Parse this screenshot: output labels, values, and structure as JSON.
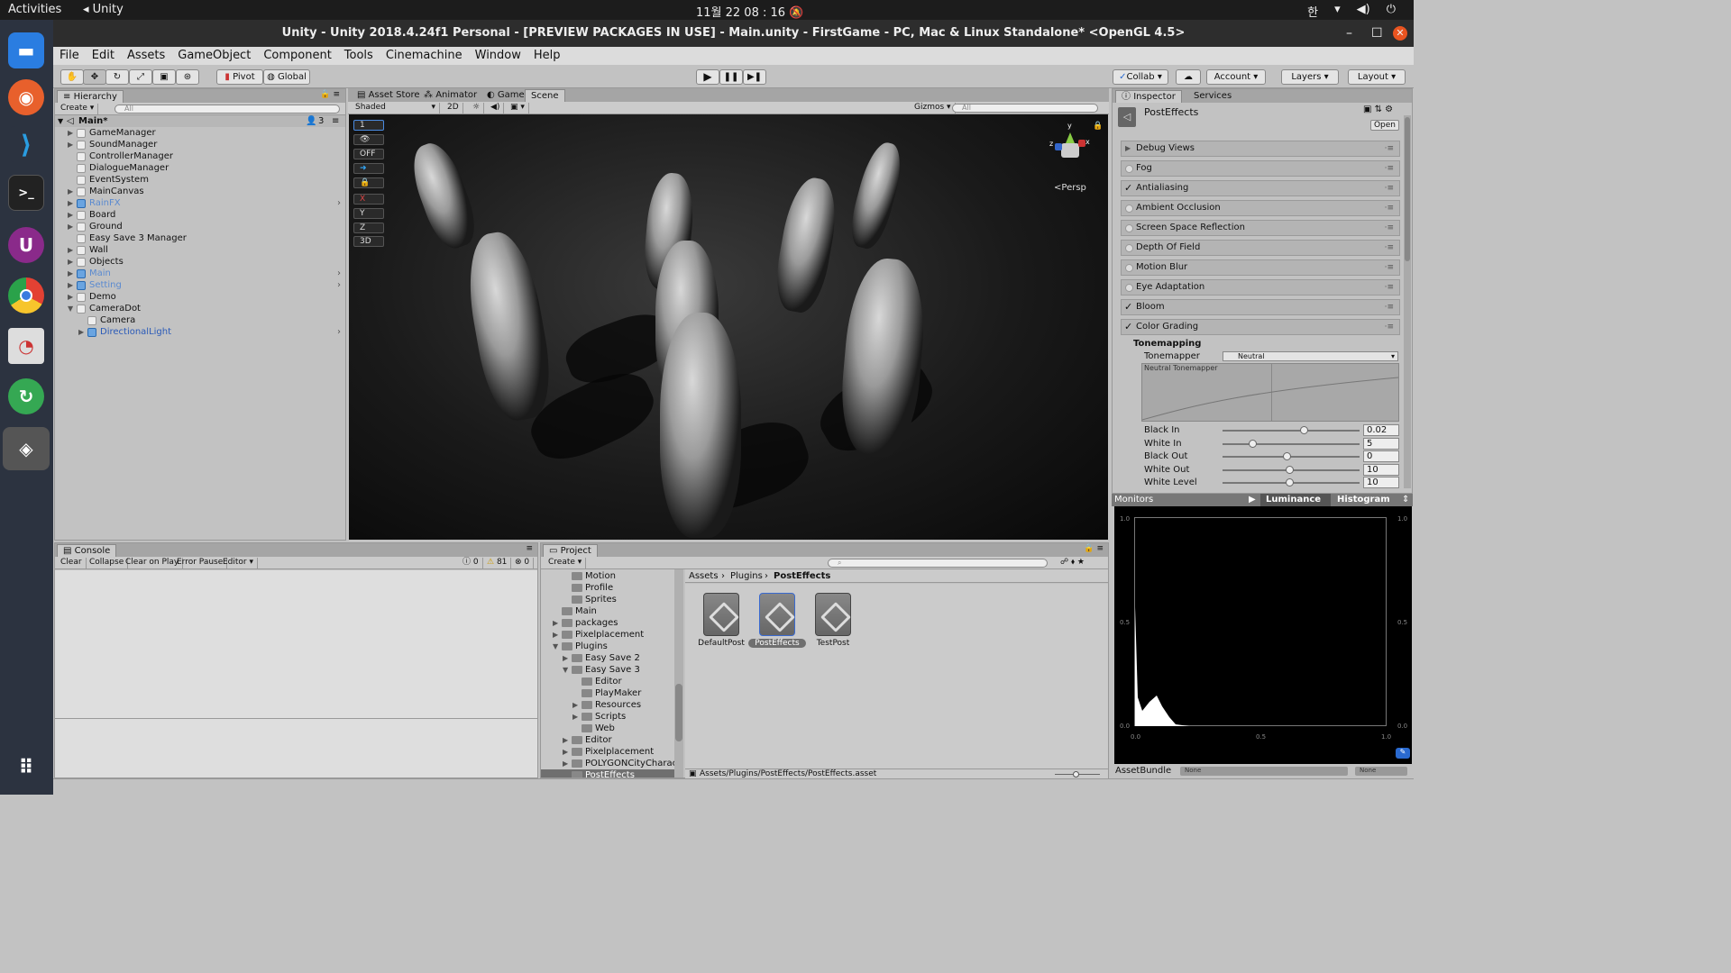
{
  "topbar": {
    "activities": "Activities",
    "app": "Unity",
    "clock": "11월 22  08 : 16",
    "lang": "한"
  },
  "window": {
    "title": "Unity - Unity 2018.4.24f1 Personal - [PREVIEW PACKAGES IN USE] - Main.unity - FirstGame - PC, Mac & Linux Standalone* <OpenGL 4.5>"
  },
  "menu": [
    "File",
    "Edit",
    "Assets",
    "GameObject",
    "Component",
    "Tools",
    "Cinemachine",
    "Window",
    "Help"
  ],
  "toolbar": {
    "pivot": "Pivot",
    "global": "Global",
    "collab": "Collab",
    "account": "Account",
    "layers": "Layers",
    "layout": "Layout"
  },
  "hierarchy": {
    "tab": "Hierarchy",
    "create": "Create",
    "search": "All",
    "scene": "Main*",
    "count": "3",
    "items": [
      {
        "label": "GameManager",
        "indent": 0,
        "arrow": true,
        "style": "normal"
      },
      {
        "label": "SoundManager",
        "indent": 0,
        "arrow": true,
        "style": "normal"
      },
      {
        "label": "ControllerManager",
        "indent": 0,
        "arrow": false,
        "style": "normal"
      },
      {
        "label": "DialogueManager",
        "indent": 0,
        "arrow": false,
        "style": "normal"
      },
      {
        "label": "EventSystem",
        "indent": 0,
        "arrow": false,
        "style": "normal"
      },
      {
        "label": "MainCanvas",
        "indent": 0,
        "arrow": true,
        "style": "normal"
      },
      {
        "label": "RainFX",
        "indent": 0,
        "arrow": true,
        "style": "prefab-dim",
        "gt": true
      },
      {
        "label": "Board",
        "indent": 0,
        "arrow": true,
        "style": "normal"
      },
      {
        "label": "Ground",
        "indent": 0,
        "arrow": true,
        "style": "normal"
      },
      {
        "label": "Easy Save 3 Manager",
        "indent": 0,
        "arrow": false,
        "style": "normal"
      },
      {
        "label": "Wall",
        "indent": 0,
        "arrow": true,
        "style": "normal"
      },
      {
        "label": "Objects",
        "indent": 0,
        "arrow": true,
        "style": "normal"
      },
      {
        "label": "Main",
        "indent": 0,
        "arrow": true,
        "style": "prefab-dim",
        "gt": true
      },
      {
        "label": "Setting",
        "indent": 0,
        "arrow": true,
        "style": "prefab-dim",
        "gt": true
      },
      {
        "label": "Demo",
        "indent": 0,
        "arrow": true,
        "style": "normal"
      },
      {
        "label": "CameraDot",
        "indent": 0,
        "arrow": true,
        "open": true,
        "style": "normal"
      },
      {
        "label": "Camera",
        "indent": 1,
        "arrow": false,
        "style": "normal"
      },
      {
        "label": "DirectionalLight",
        "indent": 1,
        "arrow": true,
        "style": "prefab",
        "gt": true
      }
    ]
  },
  "sceneTabs": [
    "Asset Store",
    "Animator",
    "Game",
    "Scene"
  ],
  "sceneBar": {
    "shading": "Shaded",
    "mode2d": "2D",
    "gizmos": "Gizmos",
    "search": "All"
  },
  "sceneTools": [
    "1",
    "",
    "OFF",
    "",
    "",
    "X",
    "Y",
    "Z",
    "3D"
  ],
  "sceneGizmo": {
    "persp": "Persp",
    "x": "x",
    "y": "y",
    "z": "z"
  },
  "inspector": {
    "tab": "Inspector",
    "services": "Services",
    "object": "PostEffects",
    "open": "Open",
    "sections": [
      {
        "label": "Debug Views",
        "state": "arrow"
      },
      {
        "label": "Fog",
        "state": "off"
      },
      {
        "label": "Antialiasing",
        "state": "on"
      },
      {
        "label": "Ambient Occlusion",
        "state": "off"
      },
      {
        "label": "Screen Space Reflection",
        "state": "off"
      },
      {
        "label": "Depth Of Field",
        "state": "off"
      },
      {
        "label": "Motion Blur",
        "state": "off"
      },
      {
        "label": "Eye Adaptation",
        "state": "off"
      },
      {
        "label": "Bloom",
        "state": "on"
      },
      {
        "label": "Color Grading",
        "state": "on"
      }
    ],
    "tonemapping": "Tonemapping",
    "tonemapper_label": "Tonemapper",
    "tonemapper_value": "Neutral",
    "curve_label": "Neutral Tonemapper",
    "sliders": [
      {
        "label": "Black In",
        "value": "0.02",
        "pos": 0.59
      },
      {
        "label": "White In",
        "value": "5",
        "pos": 0.22
      },
      {
        "label": "Black Out",
        "value": "0",
        "pos": 0.47
      },
      {
        "label": "White Out",
        "value": "10",
        "pos": 0.49
      },
      {
        "label": "White Level",
        "value": "10",
        "pos": 0.49
      }
    ]
  },
  "monitors": {
    "label": "Monitors",
    "luminance": "Luminance",
    "histogram": "Histogram",
    "y_top": "1.0",
    "y_mid": "0.5",
    "y_bot": "0.0",
    "x0": "0.0",
    "x1": "0.5",
    "x2": "1.0"
  },
  "assetbundle": {
    "label": "AssetBundle",
    "none1": "None",
    "none2": "None"
  },
  "console": {
    "tab": "Console",
    "buttons": [
      "Clear",
      "Collapse",
      "Clear on Play",
      "Error Pause",
      "Editor"
    ],
    "info": "0",
    "warn": "81",
    "err": "0"
  },
  "project": {
    "tab": "Project",
    "create": "Create",
    "tree": [
      {
        "label": "Motion",
        "indent": 2,
        "arrow": false
      },
      {
        "label": "Profile",
        "indent": 2,
        "arrow": false
      },
      {
        "label": "Sprites",
        "indent": 2,
        "arrow": false
      },
      {
        "label": "Main",
        "indent": 1,
        "arrow": false
      },
      {
        "label": "packages",
        "indent": 1,
        "arrow": true
      },
      {
        "label": "Pixelplacement",
        "indent": 1,
        "arrow": true
      },
      {
        "label": "Plugins",
        "indent": 1,
        "arrow": true,
        "open": true
      },
      {
        "label": "Easy Save 2",
        "indent": 2,
        "arrow": true
      },
      {
        "label": "Easy Save 3",
        "indent": 2,
        "arrow": true,
        "open": true
      },
      {
        "label": "Editor",
        "indent": 3,
        "arrow": false
      },
      {
        "label": "PlayMaker",
        "indent": 3,
        "arrow": false
      },
      {
        "label": "Resources",
        "indent": 3,
        "arrow": true
      },
      {
        "label": "Scripts",
        "indent": 3,
        "arrow": true
      },
      {
        "label": "Web",
        "indent": 3,
        "arrow": false
      },
      {
        "label": "Editor",
        "indent": 2,
        "arrow": true
      },
      {
        "label": "Pixelplacement",
        "indent": 2,
        "arrow": true
      },
      {
        "label": "POLYGONCityCharacte",
        "indent": 2,
        "arrow": true
      },
      {
        "label": "PostEffects",
        "indent": 2,
        "arrow": false,
        "selected": true
      }
    ],
    "breadcrumb": [
      "Assets",
      "Plugins",
      "PostEffects"
    ],
    "assets": [
      {
        "label": "DefaultPost",
        "selected": false
      },
      {
        "label": "PostEffects",
        "selected": true
      },
      {
        "label": "TestPost",
        "selected": false
      }
    ],
    "path": "Assets/Plugins/PostEffects/PostEffects.asset"
  }
}
